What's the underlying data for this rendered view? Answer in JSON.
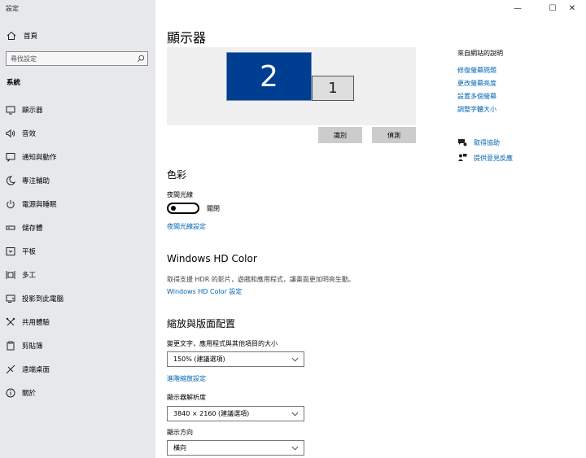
{
  "app": {
    "title": "設定",
    "minimize": "—",
    "maximize": "☐",
    "close": "✕"
  },
  "sidebar": {
    "home": "首頁",
    "search_placeholder": "尋找設定",
    "section": "系統",
    "items": [
      {
        "label": "顯示器",
        "icon": "monitor-icon"
      },
      {
        "label": "音效",
        "icon": "speaker-icon"
      },
      {
        "label": "通知與動作",
        "icon": "notification-icon"
      },
      {
        "label": "專注輔助",
        "icon": "moon-icon"
      },
      {
        "label": "電源與睡眠",
        "icon": "power-icon"
      },
      {
        "label": "儲存體",
        "icon": "storage-icon"
      },
      {
        "label": "平板",
        "icon": "tablet-icon"
      },
      {
        "label": "多工",
        "icon": "multitask-icon"
      },
      {
        "label": "投影到此電腦",
        "icon": "project-icon"
      },
      {
        "label": "共用體驗",
        "icon": "shared-icon"
      },
      {
        "label": "剪貼簿",
        "icon": "clipboard-icon"
      },
      {
        "label": "遠端桌面",
        "icon": "remote-desktop-icon"
      },
      {
        "label": "關於",
        "icon": "info-icon"
      }
    ]
  },
  "main": {
    "title": "顯示器",
    "monitors": {
      "primary": "2",
      "secondary": "1"
    },
    "identify": "識別",
    "detect": "偵測",
    "color": {
      "heading": "色彩",
      "night_light": "夜間光線",
      "toggle_state": "關閉",
      "settings_link": "夜間光線設定"
    },
    "hdr": {
      "heading": "Windows HD Color",
      "desc": "取得支援 HDR 的影片，遊戲和應用程式，讓畫面更加明亮生動。",
      "link": "Windows HD Color 設定"
    },
    "layout": {
      "heading": "縮放與版面配置",
      "scale_label": "變更文字，應用程式與其他項目的大小",
      "scale_value": "150% (建議選項)",
      "advanced_link": "進階縮放設定",
      "resolution_label": "顯示器解析度",
      "resolution_value": "3840 × 2160 (建議選項)",
      "orientation_label": "顯示方向",
      "orientation_value": "橫向"
    }
  },
  "right": {
    "heading": "來自網站的說明",
    "links": [
      "修復螢幕問題",
      "更改螢幕亮度",
      "設置多個螢幕",
      "調整字體大小"
    ],
    "get_help": "取得協助",
    "feedback": "提供意見反應"
  }
}
